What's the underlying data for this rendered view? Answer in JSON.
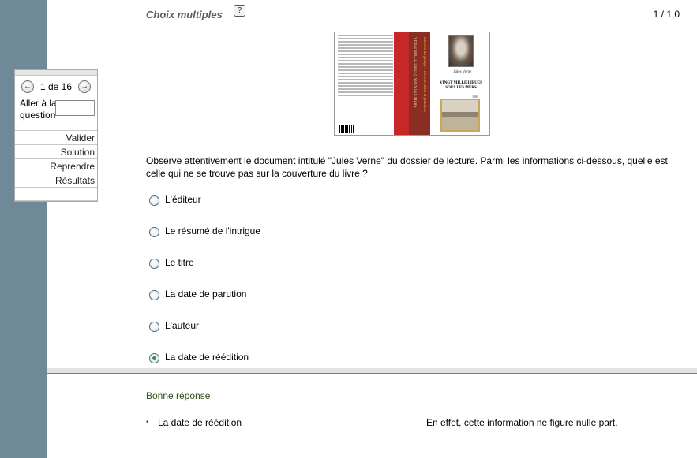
{
  "header": {
    "title": "Choix multiples",
    "help_label": "?",
    "score": "1 / 1,0"
  },
  "navigation": {
    "prev_icon": "←",
    "next_icon": "→",
    "page_indicator": "1 de 16",
    "goto_label_line1": "Aller à la",
    "goto_label_line2": "question",
    "goto_value": "",
    "menu": [
      "Valider",
      "Solution",
      "Reprendre",
      "Résultats"
    ]
  },
  "book_cover": {
    "author": "Jules Verne",
    "title_line1": "VINGT MILLE LIEUES",
    "title_line2": "SOUS LES MERS",
    "year": "1869",
    "spine_title": "VINGT MILLE LIEUES SOUS LES MERS",
    "spine_publisher": "Éditions du groupe « Ebooks libres et gratuits »"
  },
  "question": {
    "text": "Observe attentivement le document intitulé \"Jules Verne\" du dossier de lecture. Parmi les informations ci-dessous, quelle est celle qui ne se trouve pas sur la couverture du livre ?",
    "options": [
      {
        "label": "L'éditeur",
        "selected": false
      },
      {
        "label": "Le résumé de l'intrigue",
        "selected": false
      },
      {
        "label": "Le titre",
        "selected": false
      },
      {
        "label": "La date de parution",
        "selected": false
      },
      {
        "label": "L'auteur",
        "selected": false
      },
      {
        "label": "La date de réédition",
        "selected": true
      }
    ]
  },
  "feedback": {
    "title": "Bonne réponse",
    "bullet": "•",
    "answer": "La date de réédition",
    "explanation": "En effet, cette information ne figure nulle part."
  },
  "colors": {
    "left_bar": "#6e8a99",
    "selected_radio": "#3a8f3a",
    "feedback_green": "#2f4f1a"
  }
}
